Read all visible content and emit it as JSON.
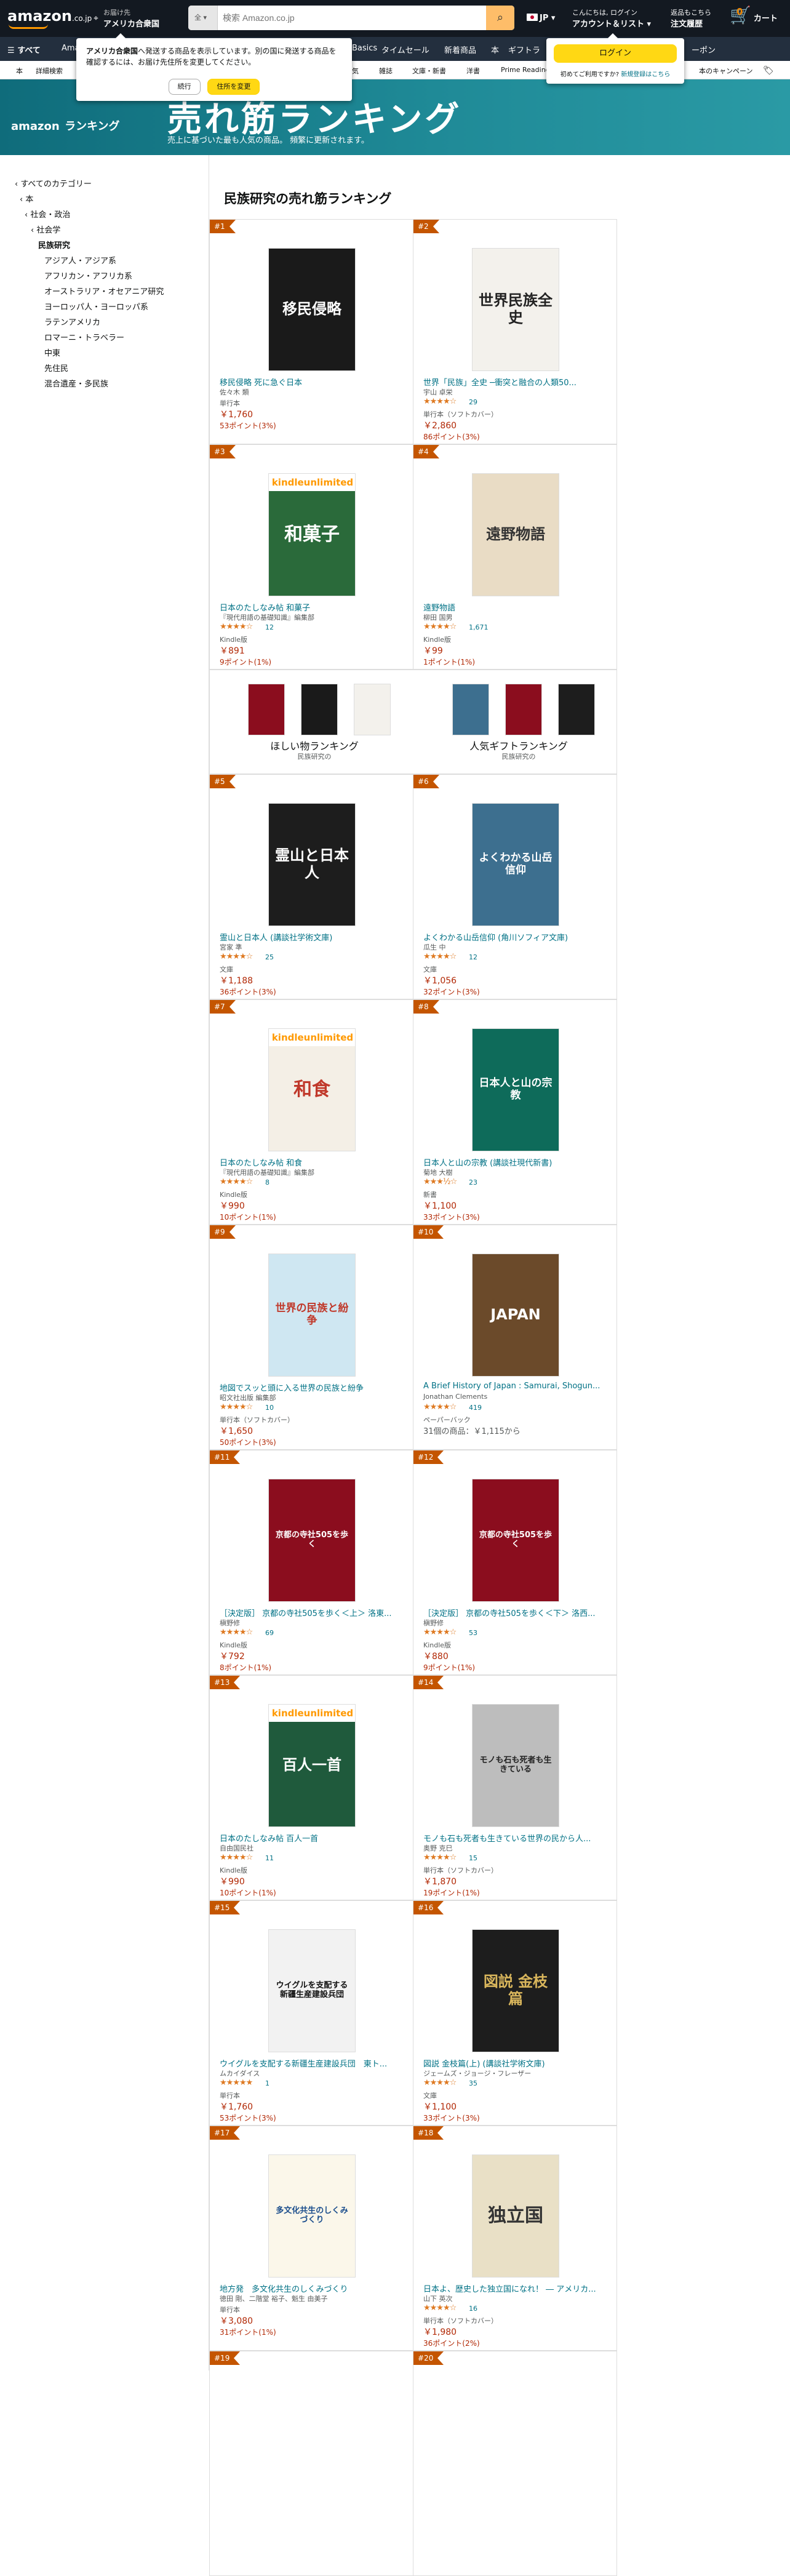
{
  "header": {
    "logo_text": "amazon",
    "logo_suffix": ".co.jp",
    "deliver_line1": "お届け先",
    "deliver_line2": "アメリカ合衆国",
    "search_category": "全",
    "search_placeholder": "検索 Amazon.co.jp",
    "lang": "JP",
    "account_line1": "こんにちは, ログイン",
    "account_line2": "アカウント＆リスト",
    "orders_line1": "返品もこちら",
    "orders_line2": "注文履歴",
    "cart_count": "0",
    "cart_label": "カート"
  },
  "navbar": {
    "all_label": "すべて",
    "items": [
      "Amazon",
      "Basics",
      "タイムセール",
      "新着商品",
      "本",
      "ギフトラ",
      "ーポン"
    ]
  },
  "subnav": {
    "items": [
      "本",
      "詳細検索",
      "",
      "",
      "",
      "",
      "",
      "気",
      "雑誌",
      "文庫・新書",
      "洋書",
      "Prime Reading",
      "",
      "",
      "本のキャンペーン"
    ]
  },
  "popover_location": {
    "text_bold": "アメリカ合衆国",
    "text": "へ発送する商品を表示しています。別の国に発送する商品を確認するには、お届け先住所を変更してください。",
    "continue_label": "続行",
    "change_label": "住所を変更"
  },
  "popover_login": {
    "login_label": "ログイン",
    "new_text": "初めてご利用ですか?",
    "new_link": "新規登録はこちら"
  },
  "banner": {
    "logo_word": "amazon",
    "logo_suffix": "ランキング",
    "title": "売れ筋ランキング",
    "subtitle": "売上に基づいた最も人気の商品。 頻繁に更新されます。"
  },
  "sidebar": {
    "items": [
      "‹ すべてのカテゴリー",
      "‹ 本",
      "‹ 社会・政治",
      "‹ 社会学",
      "民族研究",
      "アジア人・アジア系",
      "アフリカン・アフリカ系",
      "オーストラリア・オセアニア研究",
      "ヨーロッパ人・ヨーロッパ系",
      "ラテンアメリカ",
      "ロマーニ・トラベラー",
      "中東",
      "先住民",
      "混合遺産・多民族"
    ]
  },
  "main": {
    "title": "民族研究の売れ筋ランキング"
  },
  "products": [
    {
      "rank": "#1",
      "title": "移民侵略 死に急ぐ日本",
      "author": "佐々木 類",
      "stars": "",
      "reviews": "",
      "format": "単行本",
      "price": "￥1,760",
      "points": "53ポイント(3%)",
      "offers": "",
      "cover_text": "移民侵略",
      "cover_bg": "#1a1a1a",
      "cover_fg": "#ffffff"
    },
    {
      "rank": "#2",
      "title": "世界「民族」全史 ─衝突と融合の人類50...",
      "author": "宇山 卓栄",
      "stars": "★★★★☆",
      "reviews": "29",
      "format": "単行本（ソフトカバー）",
      "price": "￥2,860",
      "points": "86ポイント(3%)",
      "offers": "",
      "cover_text": "世界民族全史",
      "cover_bg": "#f3f1ec",
      "cover_fg": "#222222"
    },
    {
      "rank": "#3",
      "title": "日本のたしなみ帖 和菓子",
      "author": "『現代用語の基礎知識』編集部",
      "stars": "★★★★☆",
      "reviews": "12",
      "format": "Kindle版",
      "price": "￥891",
      "points": "9ポイント(1%)",
      "offers": "",
      "cover_text": "和菓子",
      "cover_bg": "#2a6a3a",
      "cover_fg": "#ffffff"
    },
    {
      "rank": "#4",
      "title": "遠野物語",
      "author": "柳田 国男",
      "stars": "★★★★☆",
      "reviews": "1,671",
      "format": "Kindle版",
      "price": "￥99",
      "points": "1ポイント(1%)",
      "offers": "",
      "cover_text": "遠野物語",
      "cover_bg": "#e9dcc5",
      "cover_fg": "#333333"
    },
    {
      "rank": "#5",
      "title": "霊山と日本人 (講談社学術文庫)",
      "author": "宮家 準",
      "stars": "★★★★☆",
      "reviews": "25",
      "format": "文庫",
      "price": "￥1,188",
      "points": "36ポイント(3%)",
      "offers": "",
      "cover_text": "霊山と日本人",
      "cover_bg": "#1d1d1d",
      "cover_fg": "#ffffff"
    },
    {
      "rank": "#6",
      "title": "よくわかる山岳信仰 (角川ソフィア文庫)",
      "author": "瓜生 中",
      "stars": "★★★★☆",
      "reviews": "12",
      "format": "文庫",
      "price": "￥1,056",
      "points": "32ポイント(3%)",
      "offers": "",
      "cover_text": "よくわかる山岳信仰",
      "cover_bg": "#3d6f8f",
      "cover_fg": "#ffffff"
    },
    {
      "rank": "#7",
      "title": "日本のたしなみ帖 和食",
      "author": "『現代用語の基礎知識』編集部",
      "stars": "★★★★☆",
      "reviews": "8",
      "format": "Kindle版",
      "price": "￥990",
      "points": "10ポイント(1%)",
      "offers": "",
      "cover_text": "和食",
      "cover_bg": "#f4efe6",
      "cover_fg": "#c0392b"
    },
    {
      "rank": "#8",
      "title": "日本人と山の宗教 (講談社現代新書)",
      "author": "菊地 大樹",
      "stars": "★★★½☆",
      "reviews": "23",
      "format": "新書",
      "price": "￥1,100",
      "points": "33ポイント(3%)",
      "offers": "",
      "cover_text": "日本人と山の宗教",
      "cover_bg": "#0e6b5a",
      "cover_fg": "#ffffff"
    },
    {
      "rank": "#9",
      "title": "地図でスッと頭に入る世界の民族と紛争",
      "author": "昭文社出版 編集部",
      "stars": "★★★★☆",
      "reviews": "10",
      "format": "単行本（ソフトカバー）",
      "price": "￥1,650",
      "points": "50ポイント(3%)",
      "offers": "",
      "cover_text": "世界の民族と紛争",
      "cover_bg": "#cfe7f2",
      "cover_fg": "#c0392b"
    },
    {
      "rank": "#10",
      "title": "A Brief History of Japan : Samurai, Shogun...",
      "author": "Jonathan Clements",
      "stars": "★★★★☆",
      "reviews": "419",
      "format": "ペーパーバック",
      "price": "",
      "points": "",
      "offers": "31個の商品：￥1,115から",
      "cover_text": "JAPAN",
      "cover_bg": "#6b4a2a",
      "cover_fg": "#ffffff"
    },
    {
      "rank": "#11",
      "title": "［決定版］ 京都の寺社505を歩く＜上＞ 洛東...",
      "author": "槇野修",
      "stars": "★★★★☆",
      "reviews": "69",
      "format": "Kindle版",
      "price": "￥792",
      "points": "8ポイント(1%)",
      "offers": "",
      "cover_text": "京都の寺社505を歩く",
      "cover_bg": "#8b0d1e",
      "cover_fg": "#ffffff"
    },
    {
      "rank": "#12",
      "title": "［決定版］ 京都の寺社505を歩く＜下＞ 洛西...",
      "author": "槇野修",
      "stars": "★★★★☆",
      "reviews": "53",
      "format": "Kindle版",
      "price": "￥880",
      "points": "9ポイント(1%)",
      "offers": "",
      "cover_text": "京都の寺社505を歩く",
      "cover_bg": "#8b0d1e",
      "cover_fg": "#ffffff"
    },
    {
      "rank": "#13",
      "title": "日本のたしなみ帖 百人一首",
      "author": "自由国民社",
      "stars": "★★★★☆",
      "reviews": "11",
      "format": "Kindle版",
      "price": "￥990",
      "points": "10ポイント(1%)",
      "offers": "",
      "cover_text": "百人一首",
      "cover_bg": "#1f5a3c",
      "cover_fg": "#ffffff"
    },
    {
      "rank": "#14",
      "title": "モノも石も死者も生きている世界の民から人...",
      "author": "奥野 克巳",
      "stars": "★★★★☆",
      "reviews": "15",
      "format": "単行本（ソフトカバー）",
      "price": "￥1,870",
      "points": "19ポイント(1%)",
      "offers": "",
      "cover_text": "モノも石も死者も生きている",
      "cover_bg": "#bdbdbd",
      "cover_fg": "#222222"
    },
    {
      "rank": "#15",
      "title": "ウイグルを支配する新疆生産建設兵団　東ト...",
      "author": "ムカイダイス",
      "stars": "★★★★★",
      "reviews": "1",
      "format": "単行本",
      "price": "￥1,760",
      "points": "53ポイント(3%)",
      "offers": "",
      "cover_text": "ウイグルを支配する新疆生産建設兵団",
      "cover_bg": "#f2f2f2",
      "cover_fg": "#111111"
    },
    {
      "rank": "#16",
      "title": "図説 金枝篇(上) (講談社学術文庫)",
      "author": "ジェームズ・ジョージ・フレーザー",
      "stars": "★★★★☆",
      "reviews": "35",
      "format": "文庫",
      "price": "￥1,100",
      "points": "33ポイント(3%)",
      "offers": "",
      "cover_text": "図説 金枝篇",
      "cover_bg": "#1d1d1d",
      "cover_fg": "#d9b65c"
    },
    {
      "rank": "#17",
      "title": "地方発　多文化共生のしくみづくり",
      "author": "徳田 剛、二階堂 裕子、魁生 由美子",
      "stars": "",
      "reviews": "",
      "format": "単行本",
      "price": "￥3,080",
      "points": "31ポイント(1%)",
      "offers": "",
      "cover_text": "多文化共生のしくみづくり",
      "cover_bg": "#fbf7ea",
      "cover_fg": "#1a4d8c"
    },
    {
      "rank": "#18",
      "title": "日本よ、歴史した独立国になれ！ ― アメリカ...",
      "author": "山下 英次",
      "stars": "★★★★☆",
      "reviews": "16",
      "format": "単行本（ソフトカバー）",
      "price": "￥1,980",
      "points": "36ポイント(2%)",
      "offers": "",
      "cover_text": "独立国",
      "cover_bg": "#e9e0c6",
      "cover_fg": "#333333"
    }
  ],
  "next_ranks": [
    "#19",
    "#20"
  ],
  "ads": {
    "left_label": "ほしい物ランキング",
    "left_sub": "民族研究の",
    "right_label": "人気ギフトランキング",
    "right_sub": "民族研究の"
  },
  "colors": {
    "header_bg": "#131921",
    "nav_bg": "#232f3e",
    "rank_badge": "#c45500",
    "link": "#007185",
    "price": "#b12704",
    "star": "#de7921",
    "cta": "#ffd814"
  },
  "kindle_badge": "kindleunlimited"
}
